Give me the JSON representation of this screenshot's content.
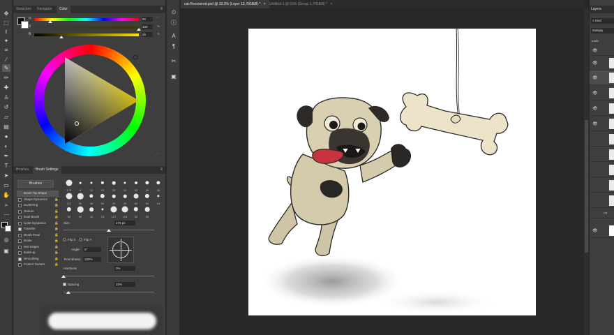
{
  "document_tabs": [
    "cat-Recovered.psd @ 33.3% (Layer 13, RGB/8) *",
    "Untitled-1 @ 50% (Group 1, RGB/8) *"
  ],
  "color_panel": {
    "tabs": [
      "Swatches",
      "Navigator",
      "Color"
    ],
    "active_tab": "Color",
    "sliders": [
      {
        "label": "H",
        "value": "52",
        "unit": "°",
        "fraction": 0.15
      },
      {
        "label": "S",
        "value": "100",
        "unit": "%",
        "fraction": 1.0
      },
      {
        "label": "B",
        "value": "26",
        "unit": "%",
        "fraction": 0.26
      }
    ]
  },
  "brush_panel": {
    "tabs": [
      "Brushes",
      "Brush Settings"
    ],
    "active_tab": "Brush Settings",
    "brushes_button": "Brushes",
    "options": [
      {
        "label": "Brush Tip Shape",
        "checked": false,
        "lock": false,
        "selected": true
      },
      {
        "label": "Shape Dynamics",
        "checked": false,
        "lock": true
      },
      {
        "label": "Scattering",
        "checked": false,
        "lock": true
      },
      {
        "label": "Texture",
        "checked": false,
        "lock": true
      },
      {
        "label": "Dual Brush",
        "checked": false,
        "lock": true
      },
      {
        "label": "Color Dynamics",
        "checked": false,
        "lock": true
      },
      {
        "label": "Transfer",
        "checked": true,
        "lock": true
      },
      {
        "label": "Brush Pose",
        "checked": false,
        "lock": true
      },
      {
        "label": "Noise",
        "checked": false,
        "lock": true
      },
      {
        "label": "Wet Edges",
        "checked": false,
        "lock": true
      },
      {
        "label": "Build-up",
        "checked": false,
        "lock": true
      },
      {
        "label": "Smoothing",
        "checked": true,
        "lock": true
      },
      {
        "label": "Protect Texture",
        "checked": false,
        "lock": true
      }
    ],
    "tip_sizes": [
      "175",
      "9",
      "11",
      "22",
      "25",
      "11",
      "20",
      "35",
      "35",
      "112",
      "90",
      "36",
      "50",
      "25",
      "25",
      "60",
      "50",
      "14",
      "50",
      "90",
      "40",
      "13",
      "127",
      "144",
      "52",
      "55"
    ],
    "size_label": "Size",
    "size_value": "175 px",
    "size_fraction": 0.5,
    "flip_x": "Flip X",
    "flip_y": "Flip Y",
    "angle_label": "Angle:",
    "angle_value": "0°",
    "roundness_label": "Roundness:",
    "roundness_value": "100%",
    "hardness_label": "Hardness",
    "hardness_value": "0%",
    "hardness_fraction": 0.0,
    "spacing_label": "Spacing",
    "spacing_value": "10%",
    "spacing_checked": true,
    "spacing_fraction": 0.05
  },
  "layers_panel": {
    "title": "Layers",
    "search_text": "Kind",
    "blend_mode": "Multiply",
    "lock_label": "Lock:"
  },
  "colors": {
    "foreground": "#111111",
    "background": "#ffffff",
    "hue_at_marker": "#ffe600"
  }
}
